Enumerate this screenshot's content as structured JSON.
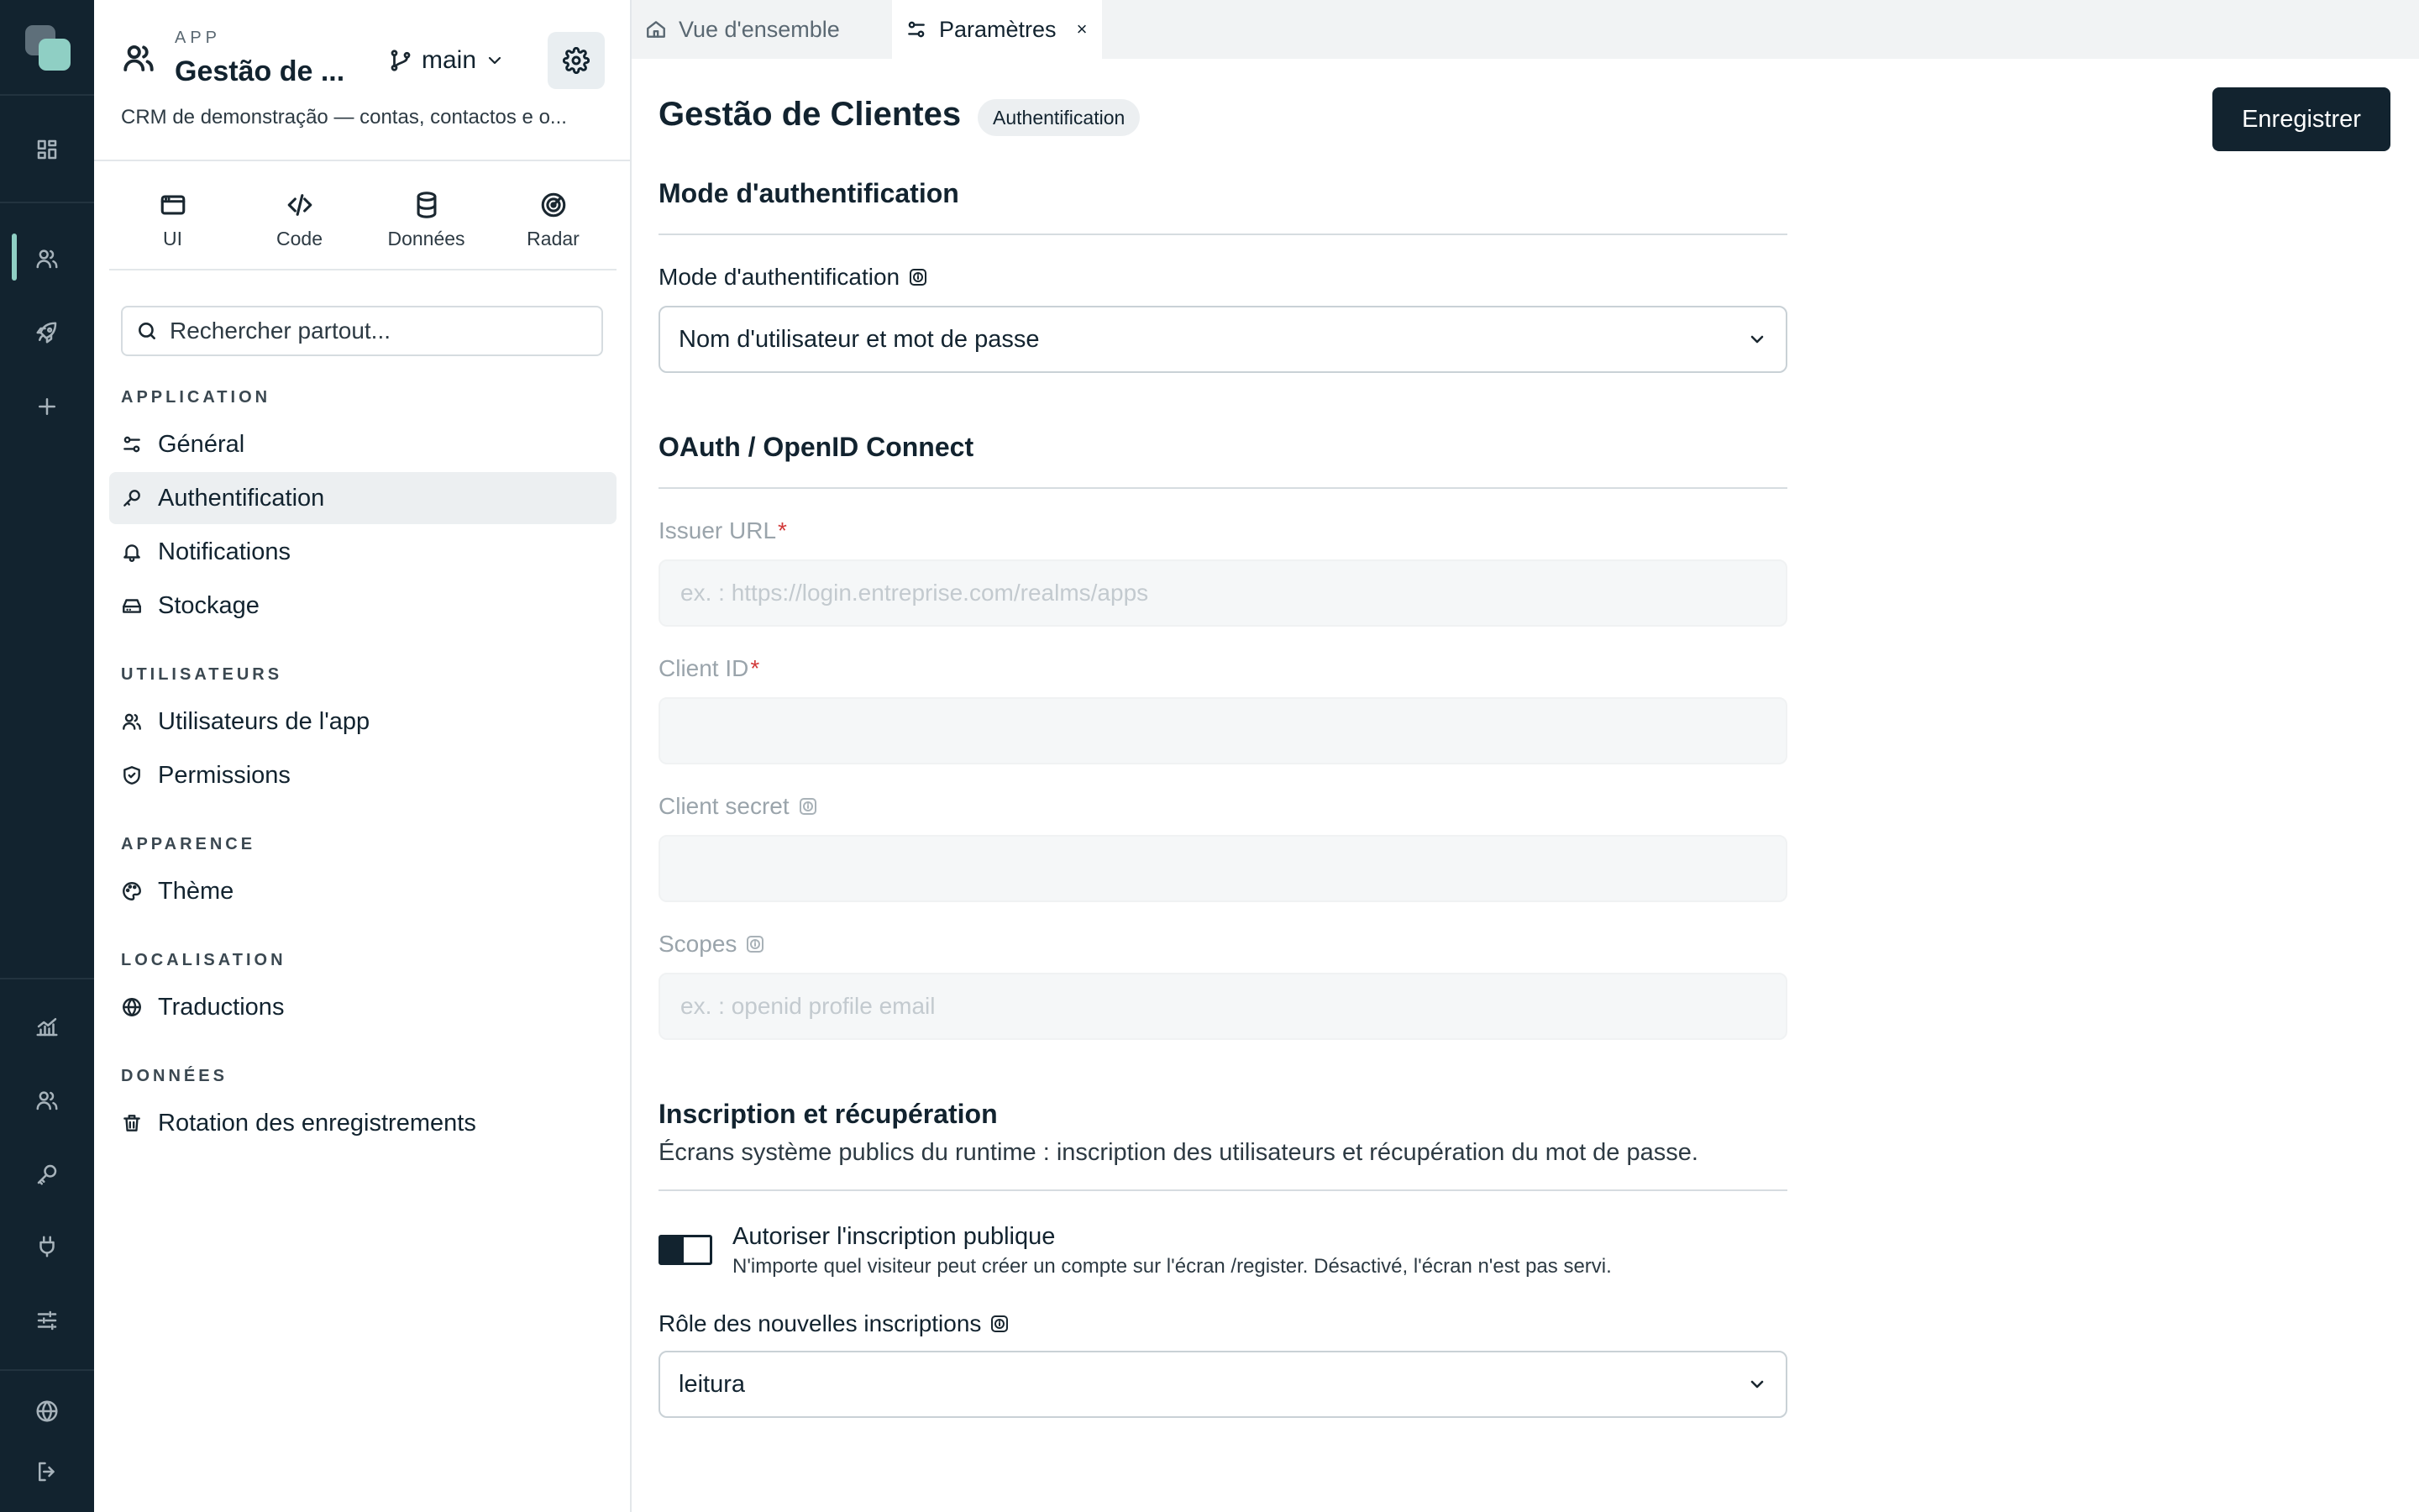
{
  "rail": {
    "icons": [
      "dashboard-icon",
      "users-icon",
      "rocket-icon",
      "plus-icon",
      "chart-icon",
      "team-icon",
      "key-icon",
      "plug-icon",
      "sliders-icon",
      "globe-icon",
      "logout-icon"
    ],
    "accent": "#8fcfc4",
    "background": "#12232f"
  },
  "sidebar": {
    "app_kicker": "APP",
    "app_title": "Gestão de ...",
    "branch": "main",
    "description": "CRM de demonstração — contas, contactos e o...",
    "modes": [
      {
        "label": "UI",
        "icon": "window-icon"
      },
      {
        "label": "Code",
        "icon": "code-icon"
      },
      {
        "label": "Données",
        "icon": "database-icon"
      },
      {
        "label": "Radar",
        "icon": "radar-icon"
      }
    ],
    "search_placeholder": "Rechercher partout...",
    "sections": {
      "application": "APPLICATION",
      "utilisateurs": "UTILISATEURS",
      "apparence": "APPARENCE",
      "localisation": "LOCALISATION",
      "donnees": "DONNÉES"
    },
    "items": {
      "general": "Général",
      "authentification": "Authentification",
      "notifications": "Notifications",
      "stockage": "Stockage",
      "app_users": "Utilisateurs de l'app",
      "permissions": "Permissions",
      "theme": "Thème",
      "traductions": "Traductions",
      "rotation": "Rotation des enregistrements"
    }
  },
  "tabs": [
    {
      "label": "Vue d'ensemble",
      "icon": "home-icon",
      "active": false
    },
    {
      "label": "Paramètres",
      "icon": "settings-sliders-icon",
      "active": true,
      "close": "×"
    }
  ],
  "main": {
    "title": "Gestão de Clientes",
    "badge": "Authentification",
    "save_label": "Enregistrer",
    "auth_section": {
      "title": "Mode d'authentification",
      "field_label": "Mode d'authentification",
      "selected": "Nom d'utilisateur et mot de passe"
    },
    "oauth_section": {
      "title": "OAuth / OpenID Connect",
      "issuer_label": "Issuer URL",
      "issuer_placeholder": "ex. : https://login.entreprise.com/realms/apps",
      "issuer_value": "",
      "client_id_label": "Client ID",
      "client_id_value": "",
      "client_secret_label": "Client secret",
      "client_secret_value": "",
      "scopes_label": "Scopes",
      "scopes_placeholder": "ex. : openid profile email",
      "scopes_value": "",
      "required_mark": "*"
    },
    "signup_section": {
      "title": "Inscription et récupération",
      "description": "Écrans système publics du runtime : inscription des utilisateurs et récupération du mot de passe.",
      "toggle_label": "Autoriser l'inscription publique",
      "toggle_help": "N'importe quel visiteur peut créer un compte sur l'écran /register. Désactivé, l'écran n'est pas servi.",
      "toggle_on": false,
      "role_label": "Rôle des nouvelles inscriptions",
      "role_selected": "leitura"
    }
  }
}
